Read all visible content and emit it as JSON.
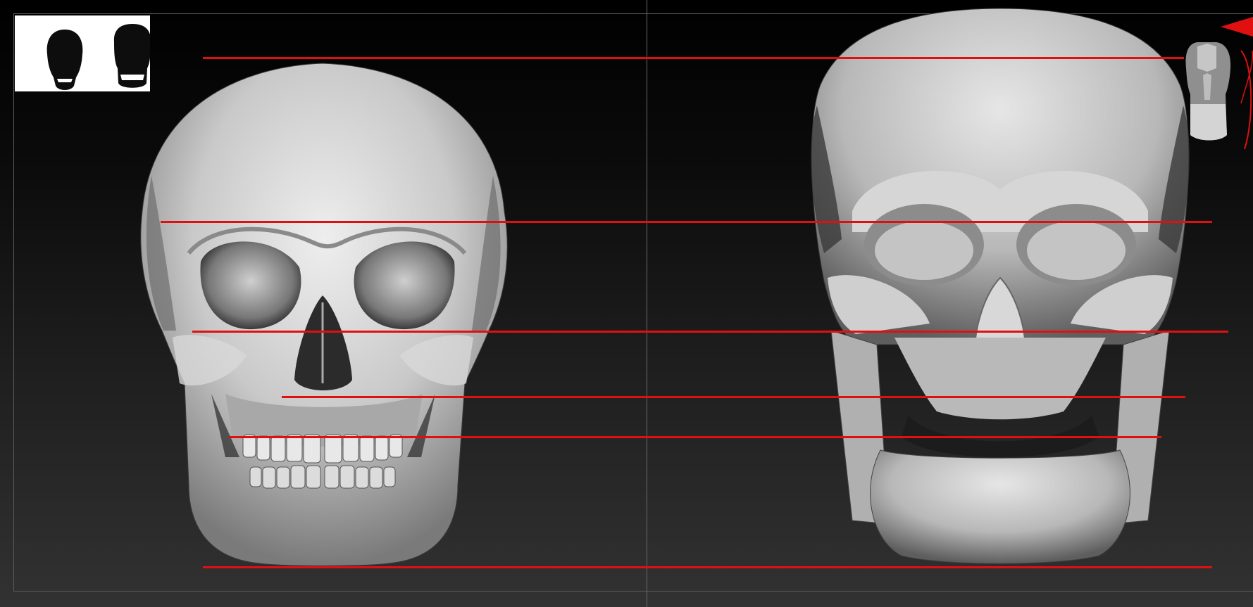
{
  "app": {
    "name": "",
    "view": "front-orthographic"
  },
  "viewport": {
    "background_top": "#000000",
    "background_bottom": "#323232",
    "frame_color": "#5a5a5a",
    "divider_color": "#6a6a6a"
  },
  "thumbnails": {
    "background": "#ffffff",
    "items": [
      {
        "icon": "skull-silhouette-icon"
      },
      {
        "icon": "stylized-skull-silhouette-icon"
      }
    ]
  },
  "models": {
    "left": {
      "icon": "realistic-skull-model"
    },
    "right": {
      "icon": "stylized-skull-model"
    }
  },
  "guides": {
    "color": "#e01010",
    "lines": [
      {
        "id": "top-of-cranium"
      },
      {
        "id": "brow-line"
      },
      {
        "id": "cheekbone-line"
      },
      {
        "id": "nose-base-line"
      },
      {
        "id": "teeth-line"
      },
      {
        "id": "chin-line"
      }
    ]
  },
  "navigator": {
    "icon": "head-navigation-gizmo-icon",
    "accent": "#e01010"
  }
}
